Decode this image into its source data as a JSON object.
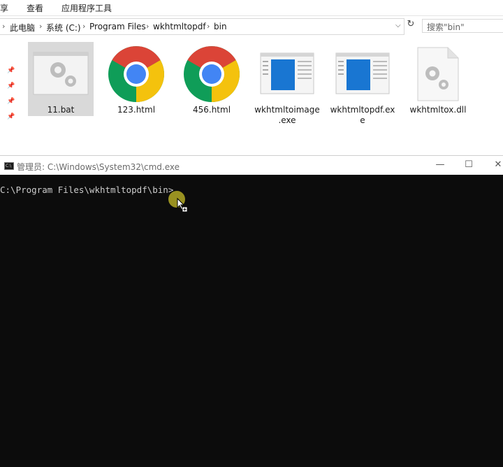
{
  "ribbon": {
    "tabs": [
      "共享",
      "查看",
      "应用程序工具"
    ]
  },
  "address": {
    "breadcrumbs": [
      "此电脑",
      "系统 (C:)",
      "Program Files",
      "wkhtmltopdf",
      "bin"
    ],
    "search_placeholder": "搜索\"bin\""
  },
  "files": [
    {
      "name_lines": [
        "11.bat"
      ],
      "icon": "bat-gear-icon",
      "selected": true
    },
    {
      "name_lines": [
        "123.html"
      ],
      "icon": "chrome-icon"
    },
    {
      "name_lines": [
        "456.html"
      ],
      "icon": "chrome-icon"
    },
    {
      "name_lines": [
        "wkhtmltoimage",
        ".exe"
      ],
      "icon": "exe-window-icon"
    },
    {
      "name_lines": [
        "wkhtmltopdf.ex",
        "e"
      ],
      "icon": "exe-window-icon"
    },
    {
      "name_lines": [
        "wkhtmltox.dll"
      ],
      "icon": "dll-gear-icon"
    }
  ],
  "cmd": {
    "title": "管理员: C:\\Windows\\System32\\cmd.exe",
    "icon_text": "C:\\",
    "prompt": "C:\\Program Files\\wkhtmltopdf\\bin>"
  },
  "colors": {
    "cmd_bg": "#0c0c0c",
    "selection": "#d9d9d9",
    "chrome_red": "#db4437",
    "chrome_yellow": "#f4c20d",
    "chrome_green": "#0f9d58",
    "chrome_blue": "#4285f4"
  }
}
